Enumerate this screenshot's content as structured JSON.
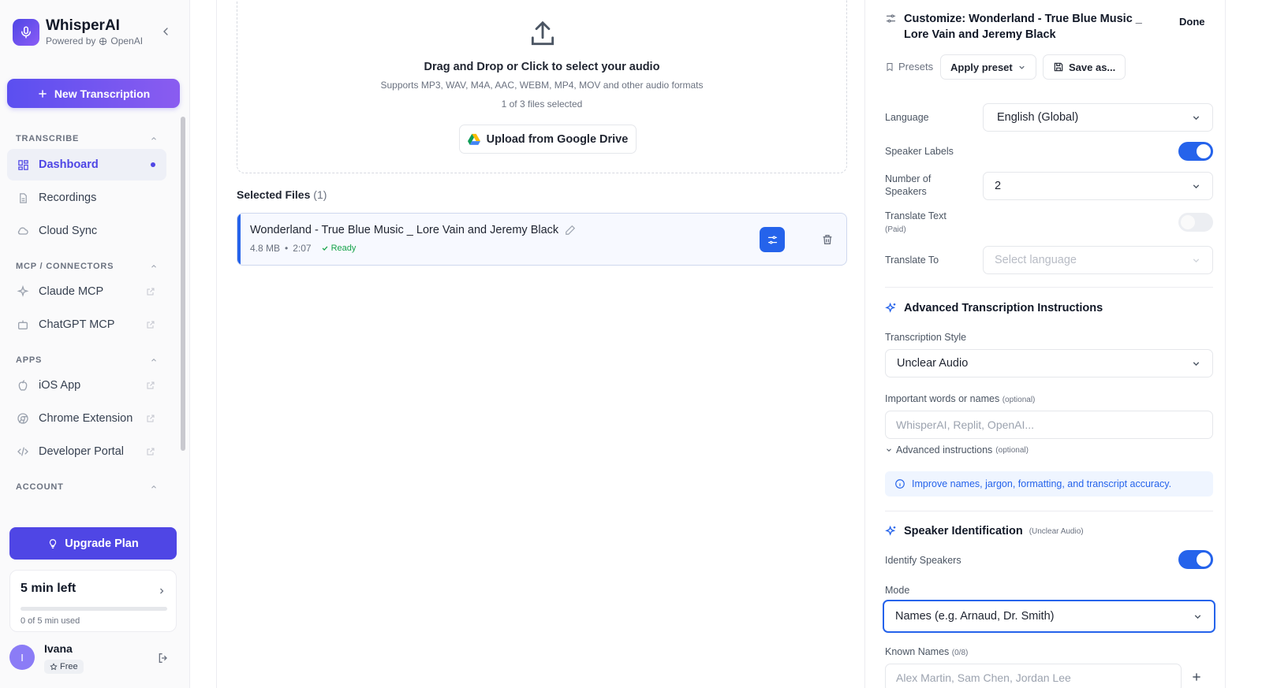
{
  "sidebar": {
    "brand_name": "WhisperAI",
    "brand_powered": "Powered by",
    "brand_provider": "OpenAI",
    "new_transcription": "New Transcription",
    "sections": {
      "transcribe": "TRANSCRIBE",
      "mcp": "MCP / CONNECTORS",
      "apps": "APPS",
      "account": "ACCOUNT"
    },
    "items": {
      "dashboard": "Dashboard",
      "recordings": "Recordings",
      "cloud_sync": "Cloud Sync",
      "claude_mcp": "Claude MCP",
      "chatgpt_mcp": "ChatGPT MCP",
      "ios_app": "iOS App",
      "chrome_extension": "Chrome Extension",
      "developer_portal": "Developer Portal"
    },
    "upgrade": "Upgrade Plan",
    "usage": {
      "title": "5 min left",
      "subtitle": "0 of 5 min used",
      "used_fraction": 0
    },
    "user": {
      "initial": "I",
      "name": "Ivana",
      "plan": "Free"
    }
  },
  "main": {
    "drop_title": "Drag and Drop or Click to select your audio",
    "drop_formats": "Supports MP3, WAV, M4A, AAC, WEBM, MP4, MOV and other audio formats",
    "drop_count": "1 of 3 files selected",
    "google_drive": "Upload from Google Drive",
    "selected_title": "Selected Files",
    "selected_count": "(1)",
    "file": {
      "name": "Wonderland - True Blue Music _ Lore Vain and Jeremy Black",
      "size": "4.8 MB",
      "duration": "2:07",
      "status": "Ready"
    }
  },
  "panel": {
    "title": "Customize: Wonderland - True Blue Music _ Lore Vain and Jeremy Black",
    "done": "Done",
    "presets": "Presets",
    "apply_preset": "Apply preset",
    "save_as": "Save as...",
    "language_label": "Language",
    "language_value": "English (Global)",
    "speaker_labels_label": "Speaker Labels",
    "speaker_labels_on": true,
    "num_speakers_label_1": "Number of",
    "num_speakers_label_2": "Speakers",
    "num_speakers_value": "2",
    "translate_label": "Translate Text",
    "translate_note": "(Paid)",
    "translate_on": false,
    "translate_to_label": "Translate To",
    "translate_to_placeholder": "Select language",
    "adv_heading": "Advanced Transcription Instructions",
    "style_label": "Transcription Style",
    "style_value": "Unclear Audio",
    "words_label": "Important words or names",
    "words_optional": "(optional)",
    "words_placeholder": "WhisperAI, Replit, OpenAI...",
    "adv_instr_label": "Advanced instructions",
    "adv_instr_optional": "(optional)",
    "info_text": "Improve names, jargon, formatting, and transcript accuracy.",
    "speaker_heading": "Speaker Identification",
    "speaker_heading_note": "(Unclear Audio)",
    "identify_label": "Identify Speakers",
    "identify_on": true,
    "mode_label": "Mode",
    "mode_value": "Names (e.g. Arnaud, Dr. Smith)",
    "known_label": "Known Names",
    "known_count": "(0/8)",
    "known_placeholder": "Alex Martin, Sam Chen, Jordan Lee"
  },
  "colors": {
    "accent": "#4f46e5",
    "primary_blue": "#2563eb",
    "ready_green": "#16a34a"
  }
}
